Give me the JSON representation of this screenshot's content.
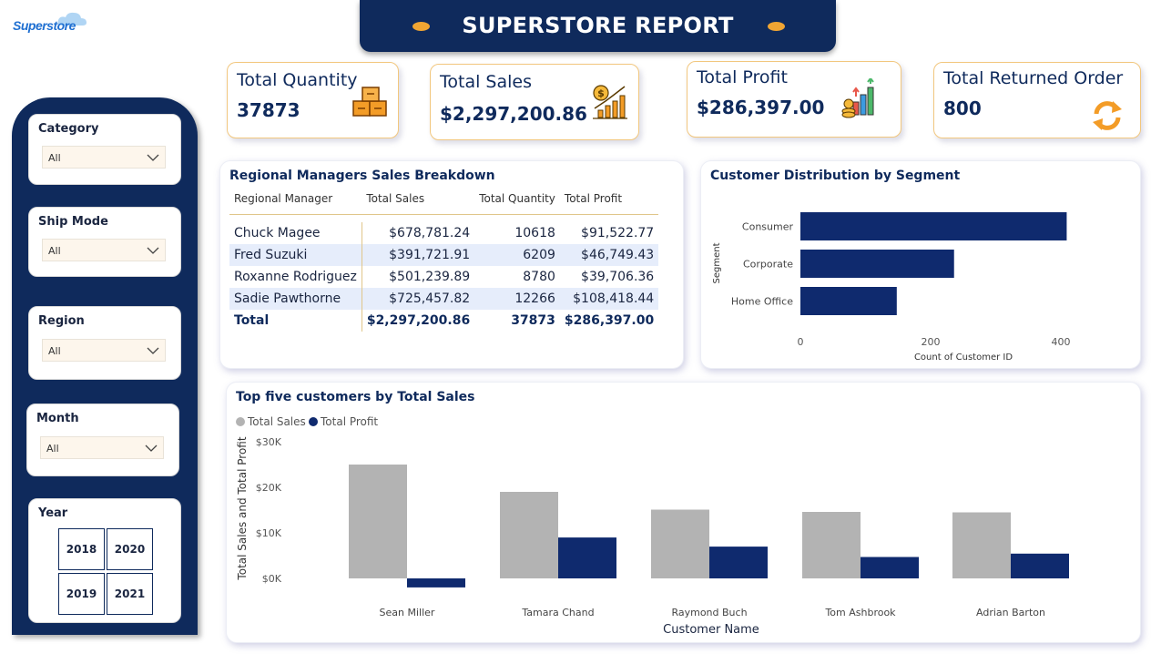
{
  "logo": {
    "text": "Superstore"
  },
  "header": {
    "title": "SUPERSTORE REPORT"
  },
  "kpis": {
    "quantity": {
      "label": "Total Quantity",
      "value": "37873",
      "icon": "boxes-icon"
    },
    "sales": {
      "label": "Total Sales",
      "value": "$2,297,200.86",
      "icon": "sales-growth-icon"
    },
    "profit": {
      "label": "Total Profit",
      "value": "$286,397.00",
      "icon": "profit-chart-icon"
    },
    "returned": {
      "label": "Total Returned Order",
      "value": "800",
      "icon": "return-arrows-icon"
    }
  },
  "filters": {
    "category": {
      "label": "Category",
      "value": "All"
    },
    "ship_mode": {
      "label": "Ship Mode",
      "value": "All"
    },
    "region": {
      "label": "Region",
      "value": "All"
    },
    "month": {
      "label": "Month",
      "value": "All"
    },
    "year": {
      "label": "Year",
      "options": [
        "2018",
        "2020",
        "2019",
        "2021"
      ]
    }
  },
  "regional_table": {
    "title": "Regional Managers Sales Breakdown",
    "columns": [
      "Regional Manager",
      "Total Sales",
      "Total Quantity",
      "Total Profit"
    ],
    "rows": [
      [
        "Chuck Magee",
        "$678,781.24",
        "10618",
        "$91,522.77"
      ],
      [
        "Fred Suzuki",
        "$391,721.91",
        "6209",
        "$46,749.43"
      ],
      [
        "Roxanne Rodriguez",
        "$501,239.89",
        "8780",
        "$39,706.36"
      ],
      [
        "Sadie Pawthorne",
        "$725,457.82",
        "12266",
        "$108,418.44"
      ]
    ],
    "total": [
      "Total",
      "$2,297,200.86",
      "37873",
      "$286,397.00"
    ]
  },
  "segment_chart": {
    "title": "Customer Distribution by Segment",
    "ylabel": "Segment",
    "xlabel": "Count of Customer ID",
    "color": "#0f2a6e"
  },
  "top_customers_chart": {
    "title": "Top five customers by Total Sales",
    "ylabel": "Total Sales and Total Profit",
    "xlabel": "Customer Name",
    "sales_color": "#b3b3b3",
    "profit_color": "#0f2a6e"
  },
  "chart_data": [
    {
      "type": "bar",
      "orientation": "horizontal",
      "title": "Customer Distribution by Segment",
      "categories": [
        "Consumer",
        "Corporate",
        "Home Office"
      ],
      "values": [
        409,
        236,
        148
      ],
      "xlabel": "Count of Customer ID",
      "ylabel": "Segment",
      "xlim": [
        0,
        450
      ],
      "xticks": [
        "0",
        "200",
        "400"
      ],
      "grid": false
    },
    {
      "type": "bar",
      "title": "Top five customers by Total Sales",
      "categories": [
        "Sean Miller",
        "Tamara Chand",
        "Raymond Buch",
        "Tom Ashbrook",
        "Adrian Barton"
      ],
      "series": [
        {
          "name": "Total Sales",
          "values": [
            25000,
            19000,
            15100,
            14600,
            14500
          ]
        },
        {
          "name": "Total Profit",
          "values": [
            -1980,
            8980,
            6980,
            4700,
            5440
          ]
        }
      ],
      "xlabel": "Customer Name",
      "ylabel": "Total Sales and Total Profit",
      "ylim": [
        -2000,
        30000
      ],
      "yticks": [
        "$0K",
        "$10K",
        "$20K",
        "$30K"
      ],
      "legend": "top-left",
      "grid": false
    }
  ]
}
